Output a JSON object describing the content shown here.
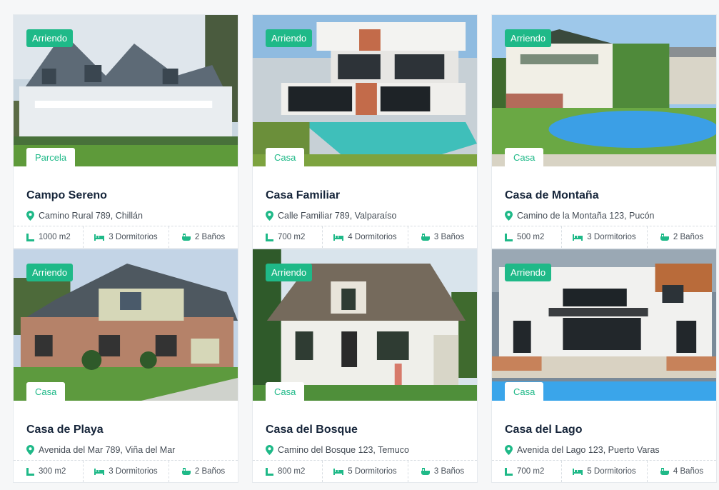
{
  "colors": {
    "accent": "#1fb988",
    "title": "#16253a"
  },
  "listings": [
    {
      "status": "Arriendo",
      "type": "Parcela",
      "title": "Campo Sereno",
      "address": "Camino Rural 789, Chillán",
      "area": "1000 m2",
      "bedrooms": "3 Dormitorios",
      "baths": "2 Baños"
    },
    {
      "status": "Arriendo",
      "type": "Casa",
      "title": "Casa Familiar",
      "address": "Calle Familiar 789, Valparaíso",
      "area": "700 m2",
      "bedrooms": "4 Dormitorios",
      "baths": "3 Baños"
    },
    {
      "status": "Arriendo",
      "type": "Casa",
      "title": "Casa de Montaña",
      "address": "Camino de la Montaña 123, Pucón",
      "area": "500 m2",
      "bedrooms": "3 Dormitorios",
      "baths": "2 Baños"
    },
    {
      "status": "Arriendo",
      "type": "Casa",
      "title": "Casa de Playa",
      "address": "Avenida del Mar 789, Viña del Mar",
      "area": "300 m2",
      "bedrooms": "3 Dormitorios",
      "baths": "2 Baños"
    },
    {
      "status": "Arriendo",
      "type": "Casa",
      "title": "Casa del Bosque",
      "address": "Camino del Bosque 123, Temuco",
      "area": "800 m2",
      "bedrooms": "5 Dormitorios",
      "baths": "3 Baños"
    },
    {
      "status": "Arriendo",
      "type": "Casa",
      "title": "Casa del Lago",
      "address": "Avenida del Lago 123, Puerto Varas",
      "area": "700 m2",
      "bedrooms": "5 Dormitorios",
      "baths": "4 Baños"
    }
  ],
  "icons": {
    "area": "area-icon",
    "bedrooms": "bed-icon",
    "baths": "bath-icon",
    "address": "map-pin-icon"
  }
}
